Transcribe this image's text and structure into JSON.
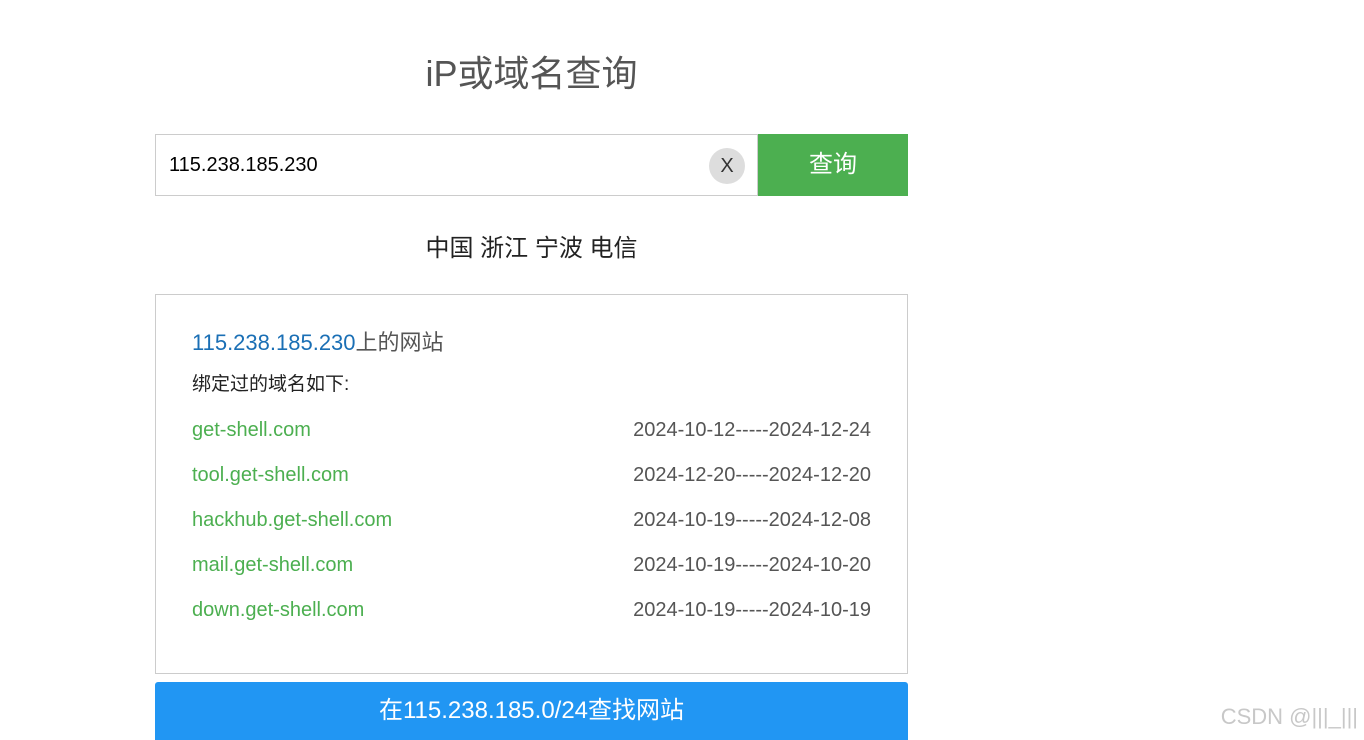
{
  "page": {
    "title": "iP或域名查询"
  },
  "search": {
    "value": "115.238.185.230",
    "clear_label": "X",
    "button_label": "查询"
  },
  "location": "中国 浙江 宁波 电信",
  "results": {
    "heading_ip": "115.238.185.230",
    "heading_suffix": "上的网站",
    "subheading": "绑定过的域名如下:",
    "domains": [
      {
        "name": "get-shell.com",
        "dates": "2024-10-12-----2024-12-24"
      },
      {
        "name": "tool.get-shell.com",
        "dates": "2024-12-20-----2024-12-20"
      },
      {
        "name": "hackhub.get-shell.com",
        "dates": "2024-10-19-----2024-12-08"
      },
      {
        "name": "mail.get-shell.com",
        "dates": "2024-10-19-----2024-10-20"
      },
      {
        "name": "down.get-shell.com",
        "dates": "2024-10-19-----2024-10-19"
      }
    ]
  },
  "find_button": {
    "label": "在115.238.185.0/24查找网站"
  },
  "watermark": "CSDN @|||_|||",
  "colors": {
    "query_button": "#4caf50",
    "find_button": "#2196f3",
    "ip_link": "#1a6fb5",
    "domain_link": "#4caf50"
  }
}
